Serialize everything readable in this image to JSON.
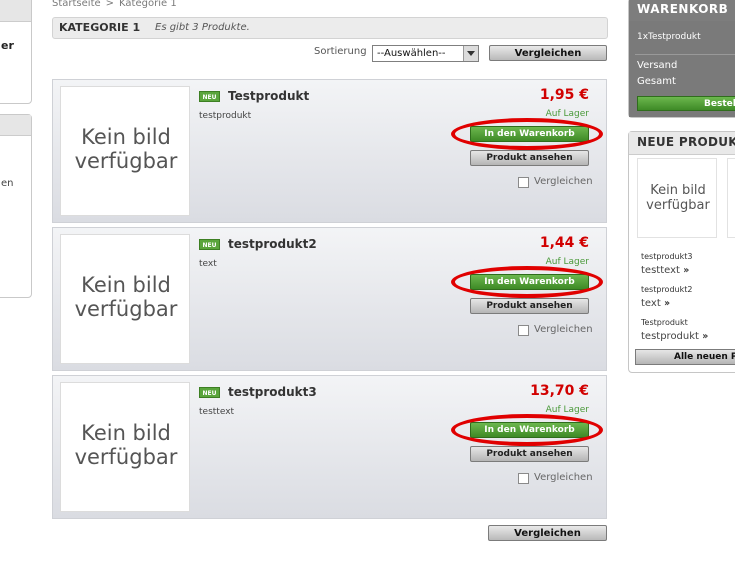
{
  "left_sidebar": {
    "box1_text": "er",
    "box2_text": "en"
  },
  "breadcrumb": {
    "home": "Startseite",
    "separator": ">",
    "current": "Kategorie 1"
  },
  "category": {
    "title": "KATEGORIE 1",
    "count_text": "Es gibt 3 Produkte."
  },
  "sorting": {
    "label": "Sortierung",
    "selected": "--Auswählen--",
    "compare_label": "Vergleichen"
  },
  "products": [
    {
      "image_text_line1": "Kein bild",
      "image_text_line2": "verfügbar",
      "badge": "NEU",
      "name": "Testprodukt",
      "description": "testprodukt",
      "price": "1,95 €",
      "stock": "Auf Lager",
      "cart_label": "In den Warenkorb",
      "view_label": "Produkt ansehen",
      "compare_label": "Vergleichen"
    },
    {
      "image_text_line1": "Kein bild",
      "image_text_line2": "verfügbar",
      "badge": "NEU",
      "name": "testprodukt2",
      "description": "text",
      "price": "1,44 €",
      "stock": "Auf Lager",
      "cart_label": "In den Warenkorb",
      "view_label": "Produkt ansehen",
      "compare_label": "Vergleichen"
    },
    {
      "image_text_line1": "Kein bild",
      "image_text_line2": "verfügbar",
      "badge": "NEU",
      "name": "testprodukt3",
      "description": "testtext",
      "price": "13,70 €",
      "stock": "Auf Lager",
      "cart_label": "In den Warenkorb",
      "view_label": "Produkt ansehen",
      "compare_label": "Vergleichen"
    }
  ],
  "compare_bottom_label": "Vergleichen",
  "cart": {
    "title": "WARENKORB",
    "item": "1xTestprodukt",
    "shipping_label": "Versand",
    "total_label": "Gesamt",
    "order_button": "Bestel"
  },
  "new_products": {
    "title": "NEUE PRODUK",
    "thumb_line1": "Kein bild",
    "thumb_line2": "verfügbar",
    "items": [
      {
        "name": "testprodukt3",
        "desc": "testtext"
      },
      {
        "name": "testprodukt2",
        "desc": "text"
      },
      {
        "name": "Testprodukt",
        "desc": "testprodukt"
      }
    ],
    "all_button": "Alle neuen P"
  },
  "colors": {
    "price": "#d10000",
    "cart_button": "#4b9a31",
    "highlight_ring": "#e00000"
  }
}
